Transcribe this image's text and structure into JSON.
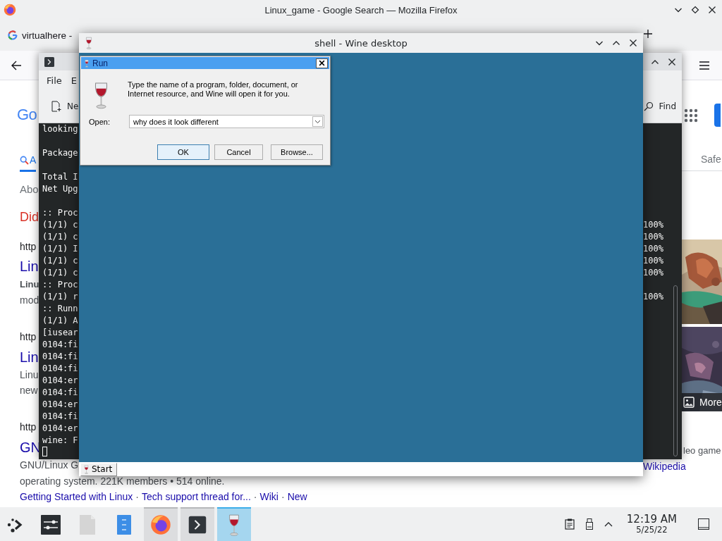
{
  "firefox": {
    "title": "Linux_game - Google Search — Mozilla Firefox",
    "tabs": [
      {
        "label": "virtualhere -",
        "selected": false
      }
    ],
    "page": {
      "left": [
        {
          "kind": "logo",
          "text": "Go"
        },
        {
          "kind": "tab",
          "text": "A",
          "selected": true
        },
        {
          "kind": "meta",
          "text": "Abo"
        },
        {
          "kind": "suggestion",
          "text": "Did"
        },
        {
          "kind": "url",
          "text": "http"
        },
        {
          "kind": "title",
          "text": "Lin"
        },
        {
          "kind": "bold",
          "text": "Linu"
        },
        {
          "kind": "snippet",
          "text": "mod"
        },
        {
          "kind": "url",
          "text": "http"
        },
        {
          "kind": "title",
          "text": "Lin"
        },
        {
          "kind": "snippet",
          "text": "Linu"
        },
        {
          "kind": "snippet",
          "text": "new"
        },
        {
          "kind": "url",
          "text": "http"
        },
        {
          "kind": "title",
          "text": "GN"
        },
        {
          "kind": "snippet",
          "text": "GNU/Linux G"
        },
        {
          "kind": "snippet",
          "text": "operating system. 221K members • 514 online."
        },
        {
          "kind": "links",
          "separator": "·",
          "links": [
            "Getting Started with Linux",
            "Tech support thread for...",
            "Wiki",
            "New"
          ]
        }
      ],
      "right": {
        "filter": "Safe",
        "images_button": "More",
        "snippet": "leo game",
        "source_link": "Wikipedia"
      }
    }
  },
  "konsole": {
    "menu": [
      "File",
      "E"
    ],
    "toolbar": [
      {
        "kind": "new-tab",
        "label": "Ne"
      },
      {
        "kind": "find",
        "label": "Find"
      }
    ],
    "lines": [
      {
        "kind": "text",
        "text": "looking"
      },
      {
        "kind": "blank"
      },
      {
        "kind": "text",
        "text": "Package"
      },
      {
        "kind": "blank"
      },
      {
        "kind": "text",
        "text": "Total I"
      },
      {
        "kind": "text",
        "text": "Net Upg"
      },
      {
        "kind": "blank"
      },
      {
        "kind": "text",
        "text": ":: Proc"
      },
      {
        "kind": "text",
        "text": "(1/1) c",
        "percent": "100%"
      },
      {
        "kind": "text",
        "text": "(1/1) c",
        "percent": "100%"
      },
      {
        "kind": "text",
        "text": "(1/1) I",
        "percent": "100%"
      },
      {
        "kind": "text",
        "text": "(1/1) c",
        "percent": "100%"
      },
      {
        "kind": "text",
        "text": "(1/1) c",
        "percent": "100%"
      },
      {
        "kind": "text",
        "text": ":: Proc"
      },
      {
        "kind": "text",
        "text": "(1/1) r",
        "percent": "100%"
      },
      {
        "kind": "text",
        "text": ":: Runn"
      },
      {
        "kind": "text",
        "text": "(1/1) A"
      },
      {
        "kind": "text",
        "text": "[iusear"
      },
      {
        "kind": "text",
        "text": "0104:fi"
      },
      {
        "kind": "text",
        "text": "0104:fi"
      },
      {
        "kind": "text",
        "text": "0104:fi"
      },
      {
        "kind": "text",
        "text": "0104:er"
      },
      {
        "kind": "text",
        "text": "0104:fi"
      },
      {
        "kind": "text",
        "text": "0104:er"
      },
      {
        "kind": "text",
        "text": "0104:fi"
      },
      {
        "kind": "text",
        "text": "0104:er"
      },
      {
        "kind": "text",
        "text": "wine: F"
      },
      {
        "kind": "cursor"
      }
    ]
  },
  "wine_desktop": {
    "title": "shell - Wine desktop",
    "start_button": "Start"
  },
  "run_dialog": {
    "title": "Run",
    "message": "Type the name of a program, folder, document, or Internet resource, and Wine will open it for you.",
    "open_label": "Open:",
    "open_value": "why does it look different",
    "buttons": [
      {
        "label": "OK",
        "default": true
      },
      {
        "label": "Cancel",
        "default": false
      },
      {
        "label": "Browse...",
        "default": false
      }
    ]
  },
  "panel": {
    "apps": [
      {
        "kind": "launcher",
        "open": false,
        "selected": false
      },
      {
        "kind": "settings",
        "open": false,
        "selected": false
      },
      {
        "kind": "file",
        "open": false,
        "selected": false
      },
      {
        "kind": "files",
        "open": false,
        "selected": false
      },
      {
        "kind": "firefox",
        "open": true,
        "selected": false
      },
      {
        "kind": "terminal",
        "open": true,
        "selected": false
      },
      {
        "kind": "wine",
        "open": true,
        "selected": true
      }
    ],
    "tray": [
      {
        "kind": "clipboard"
      },
      {
        "kind": "usb"
      },
      {
        "kind": "expand"
      }
    ],
    "time": "12:19 AM",
    "date": "5/25/22"
  }
}
